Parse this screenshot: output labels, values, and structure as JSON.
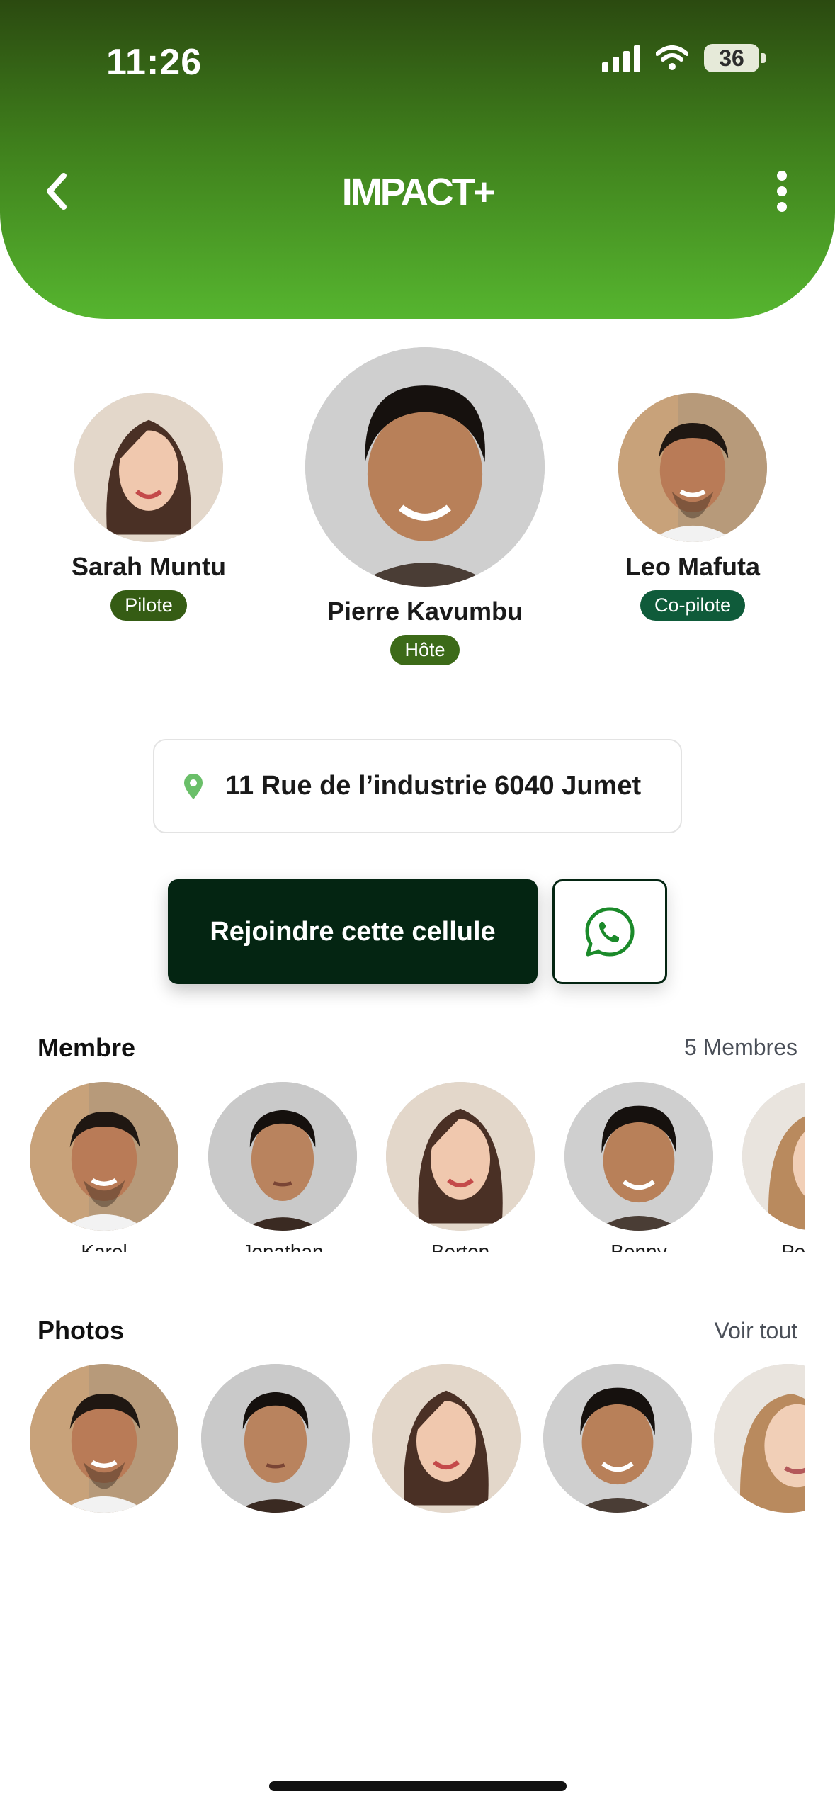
{
  "status_bar": {
    "time": "11:26",
    "battery": "36"
  },
  "header": {
    "title": "IMPACT+"
  },
  "leaders": [
    {
      "name": "Sarah Muntu",
      "role": "Pilote",
      "role_color": "#355c14"
    },
    {
      "name": "Pierre Kavumbu",
      "role": "Hôte",
      "role_color": "#3c6a18"
    },
    {
      "name": "Leo Mafuta",
      "role": "Co-pilote",
      "role_color": "#0f5b3a"
    }
  ],
  "address": {
    "text": "11 Rue de l’industrie 6040 Jumet",
    "icon": "location-pin-icon"
  },
  "actions": {
    "join_label": "Rejoindre cette cellule",
    "whatsapp_icon": "whatsapp-icon"
  },
  "members": {
    "title": "Membre",
    "count_label": "5 Membres",
    "items": [
      {
        "name": "Karel"
      },
      {
        "name": "Jonathan"
      },
      {
        "name": "Berton"
      },
      {
        "name": "Benny"
      },
      {
        "name": "Pe"
      }
    ]
  },
  "photos": {
    "title": "Photos",
    "see_all": "Voir tout"
  },
  "colors": {
    "header_dark": "#2b4a10",
    "header_light": "#56b52f",
    "join_button": "#042512",
    "pin": "#6abf69"
  }
}
